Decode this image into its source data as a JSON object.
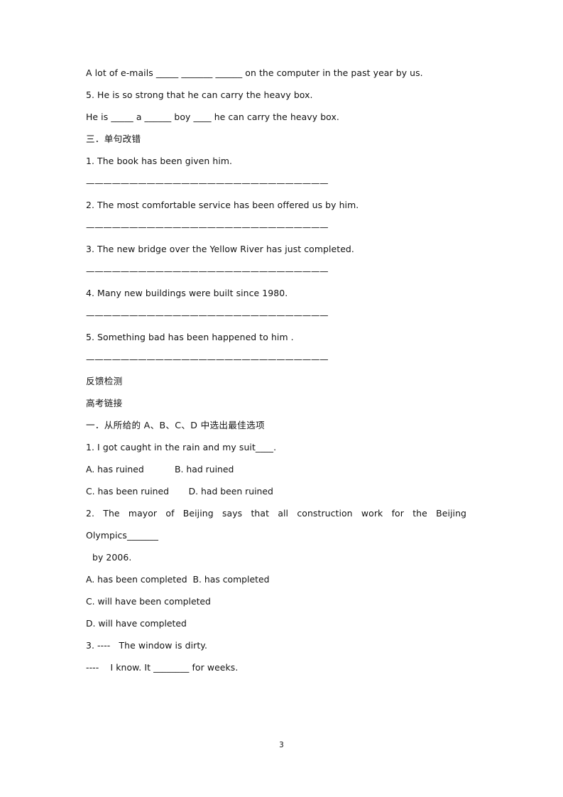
{
  "page": {
    "number": "3",
    "paper_color": "#ffffff",
    "text_color": "#111111"
  },
  "body": {
    "blocks": [
      {
        "id": "fill-blank-continuation",
        "kind": "text",
        "text": "A lot of e-mails _____ _______ ______ on the computer in the past year by us."
      },
      {
        "id": "exercise-2-item-5-prompt",
        "kind": "text",
        "text": "5. He is so strong that he can carry the heavy box."
      },
      {
        "id": "exercise-2-item-5-answer",
        "kind": "text",
        "text": "He is _____ a ______ boy ____ he can carry the heavy box."
      },
      {
        "id": "section-three-heading",
        "kind": "heading-cn",
        "text": "三．单句改错"
      },
      {
        "id": "correction-item-1",
        "kind": "text",
        "text": "1. The book has been given him."
      },
      {
        "id": "correction-rule-1",
        "kind": "rule",
        "text": "————————————————————————————"
      },
      {
        "id": "correction-item-2",
        "kind": "text",
        "text": "2. The most comfortable service has been offered us by him."
      },
      {
        "id": "correction-rule-2",
        "kind": "rule",
        "text": "————————————————————————————"
      },
      {
        "id": "correction-item-3",
        "kind": "text",
        "text": "3. The new bridge over the Yellow River has just completed."
      },
      {
        "id": "correction-rule-3",
        "kind": "rule",
        "text": "————————————————————————————"
      },
      {
        "id": "correction-item-4",
        "kind": "text",
        "text": "4. Many new buildings were built since 1980."
      },
      {
        "id": "correction-rule-4",
        "kind": "rule",
        "text": "————————————————————————————"
      },
      {
        "id": "correction-item-5",
        "kind": "text",
        "text": "5. Something bad has been happened to him ."
      },
      {
        "id": "correction-rule-5",
        "kind": "rule",
        "text": "————————————————————————————"
      },
      {
        "id": "feedback-test-heading",
        "kind": "heading-cn",
        "text": "反馈检测"
      },
      {
        "id": "gaokao-link-heading",
        "kind": "heading-cn",
        "text": "高考链接"
      },
      {
        "id": "section-one-heading",
        "kind": "heading-cn",
        "text": "一．从所给的 A、B、C、D 中选出最佳选项"
      },
      {
        "id": "mc-question-1",
        "kind": "text",
        "text": "1. I got caught in the rain and my suit____."
      },
      {
        "id": "mc-question-1-options-ab",
        "kind": "options",
        "text": "A. has ruined           B. had ruined"
      },
      {
        "id": "mc-question-1-options-cd",
        "kind": "options",
        "text": "C. has been ruined       D. had been ruined"
      },
      {
        "id": "mc-question-2",
        "kind": "justified",
        "text": "2. The mayor of Beijing says that all construction work for the Beijing"
      },
      {
        "id": "mc-question-2-cont",
        "kind": "text",
        "text": "Olympics_______"
      },
      {
        "id": "mc-question-2-cont2",
        "kind": "indent",
        "text": "by 2006."
      },
      {
        "id": "mc-question-2-options-ab",
        "kind": "options",
        "text": "A. has been completed  B. has completed"
      },
      {
        "id": "mc-question-2-options-c",
        "kind": "options",
        "text": "C. will have been completed"
      },
      {
        "id": "mc-question-2-options-d",
        "kind": "options",
        "text": "D. will have completed"
      },
      {
        "id": "mc-question-3-line-1",
        "kind": "text",
        "text": "3. ----   The window is dirty."
      },
      {
        "id": "mc-question-3-line-2",
        "kind": "text",
        "text": "----    I know. It ________ for weeks."
      }
    ]
  }
}
